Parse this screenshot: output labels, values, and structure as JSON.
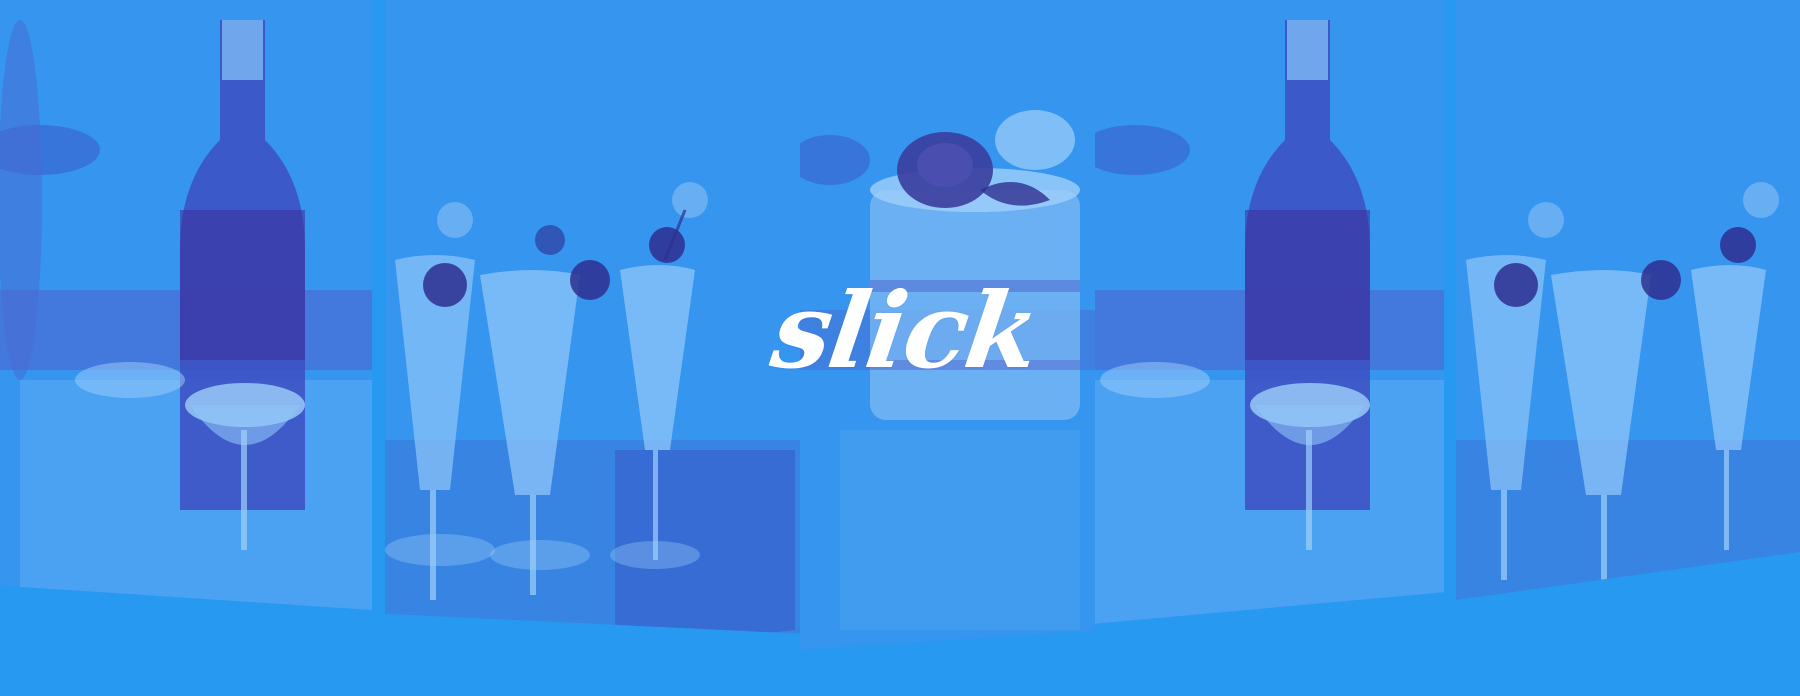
{
  "brand": {
    "logo_text": "slick"
  },
  "colors": {
    "background": "#2799f0",
    "photo_tint": "#2f8ff0",
    "shadow_tone": "#3c4fc4",
    "highlight_tone": "#8fc8fb",
    "logo": "#ffffff"
  },
  "gallery": {
    "panels": [
      {
        "subject": "champagne-bottle"
      },
      {
        "subject": "champagne-flutes-with-berries"
      },
      {
        "subject": "layer-cake-with-rose"
      },
      {
        "subject": "champagne-bottle"
      },
      {
        "subject": "champagne-flutes-with-berries"
      }
    ]
  }
}
